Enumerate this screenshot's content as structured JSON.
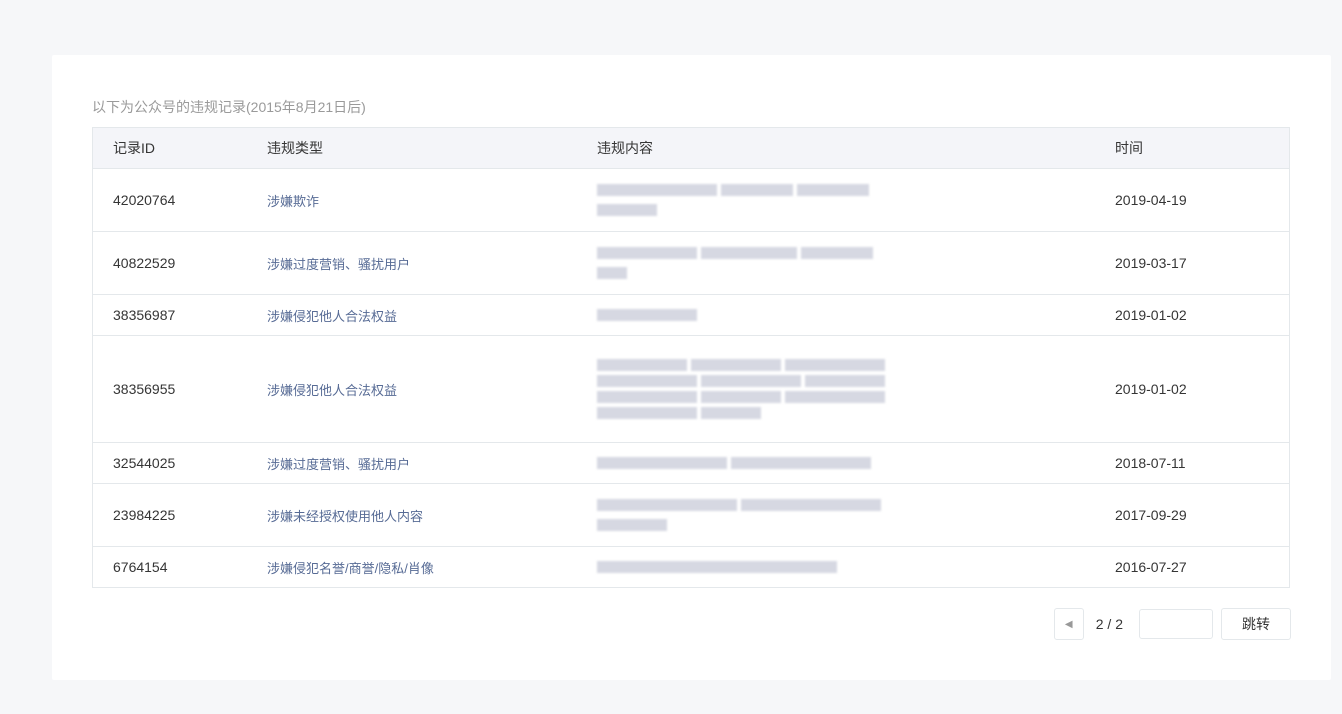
{
  "note": "以下为公众号的违规记录(2015年8月21日后)",
  "headers": {
    "id": "记录ID",
    "type": "违规类型",
    "content": "违规内容",
    "time": "时间"
  },
  "rows": [
    {
      "id": "42020764",
      "type": "涉嫌欺诈",
      "time": "2019-04-19"
    },
    {
      "id": "40822529",
      "type": "涉嫌过度营销、骚扰用户",
      "time": "2019-03-17"
    },
    {
      "id": "38356987",
      "type": "涉嫌侵犯他人合法权益",
      "time": "2019-01-02"
    },
    {
      "id": "38356955",
      "type": "涉嫌侵犯他人合法权益",
      "time": "2019-01-02"
    },
    {
      "id": "32544025",
      "type": "涉嫌过度营销、骚扰用户",
      "time": "2018-07-11"
    },
    {
      "id": "23984225",
      "type": "涉嫌未经授权使用他人内容",
      "time": "2017-09-29"
    },
    {
      "id": "6764154",
      "type": "涉嫌侵犯名誉/商誉/隐私/肖像",
      "time": "2016-07-27"
    }
  ],
  "pagination": {
    "page_label": "2 / 2",
    "input_value": "",
    "jump_label": "跳转"
  }
}
